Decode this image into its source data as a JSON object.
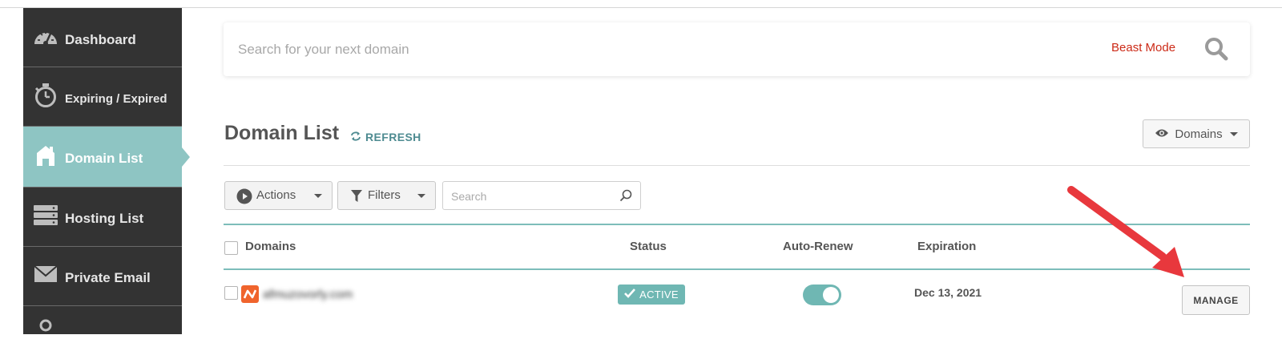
{
  "sidebar": {
    "items": [
      {
        "label": "Dashboard",
        "icon": "speedometer-icon",
        "active": false
      },
      {
        "label": "Expiring / Expired",
        "icon": "stopwatch-icon",
        "active": false
      },
      {
        "label": "Domain List",
        "icon": "home-icon",
        "active": true
      },
      {
        "label": "Hosting List",
        "icon": "server-icon",
        "active": false
      },
      {
        "label": "Private Email",
        "icon": "envelope-icon",
        "active": false
      }
    ]
  },
  "search": {
    "placeholder": "Search for your next domain",
    "beast_mode_label": "Beast Mode"
  },
  "header": {
    "title": "Domain List",
    "refresh_label": "REFRESH",
    "view_label": "Domains"
  },
  "toolbar": {
    "actions_label": "Actions",
    "filters_label": "Filters",
    "search_placeholder": "Search"
  },
  "table": {
    "columns": [
      "Domains",
      "Status",
      "Auto-Renew",
      "Expiration"
    ],
    "rows": [
      {
        "domain": "afmuzovorly.com",
        "status": "ACTIVE",
        "auto_renew": true,
        "expiration": "Dec 13, 2021",
        "manage_label": "MANAGE"
      }
    ]
  },
  "colors": {
    "sidebar_bg": "#333333",
    "active_teal": "#8ec5c3",
    "accent_red": "#cc2a17",
    "annotation_arrow": "#e8383d"
  }
}
